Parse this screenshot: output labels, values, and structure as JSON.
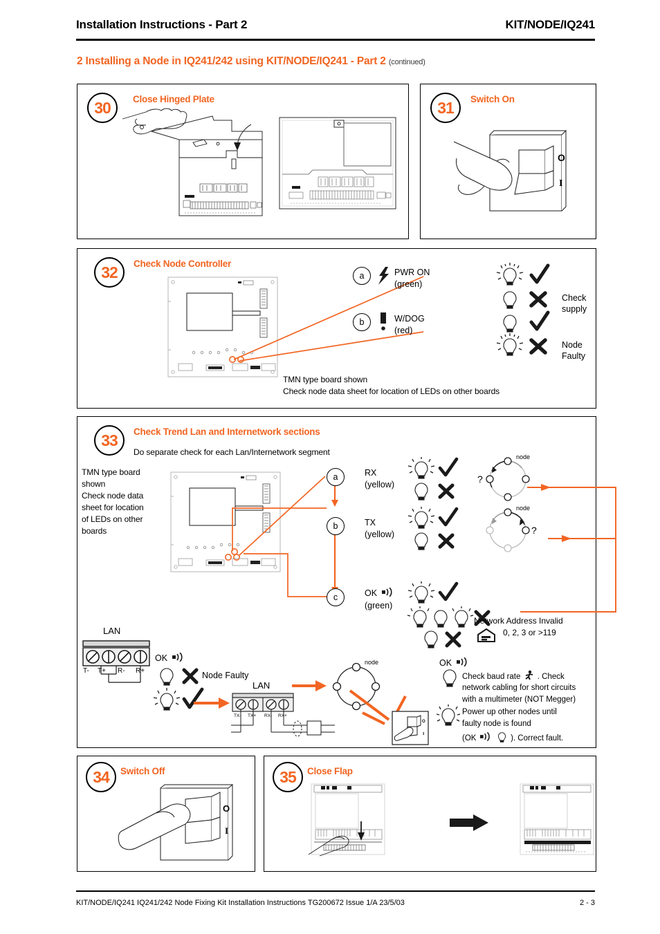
{
  "header": {
    "title": "Installation Instructions - Part 2",
    "product": "KIT/NODE/IQ241"
  },
  "section": {
    "heading": "2 Installing a Node in IQ241/242 using KIT/NODE/IQ241 - Part 2",
    "continued": "(continued)"
  },
  "steps": [
    {
      "number": "30",
      "title": "Close Hinged Plate"
    },
    {
      "number": "31",
      "title": "Switch On",
      "switch_labels": {
        "off": "O",
        "on": "I"
      }
    },
    {
      "number": "32",
      "title": "Check Node Controller",
      "callouts": [
        {
          "ref": "a",
          "icon": "lightning-icon",
          "led": "PWR ON",
          "colour": "(green)",
          "ok_result": "",
          "fail_result": "Check supply"
        },
        {
          "ref": "b",
          "icon": "exclamation-icon",
          "led": "W/DOG",
          "colour": "(red)",
          "ok_result": "",
          "fail_result": "Node Faulty"
        }
      ],
      "note_line1": "TMN type board shown",
      "note_line2": "Check node data sheet for location of LEDs on other boards"
    },
    {
      "number": "33",
      "title": "Check Trend Lan and Internetwork sections",
      "subtitle": "Do separate check for each Lan/Internetwork segment",
      "side_note": "TMN type board shown\nCheck node data sheet for location of LEDs on other boards",
      "side_note_lines": [
        "TMN type board",
        "shown",
        "Check node data",
        "sheet for location",
        "of LEDs on other",
        "boards"
      ],
      "callouts": [
        {
          "ref": "a",
          "led": "RX",
          "colour": "(yellow)",
          "ring_label": "node",
          "ring_query": "?"
        },
        {
          "ref": "b",
          "led": "TX",
          "colour": "(yellow)",
          "ring_label": "node",
          "ring_query": "?"
        },
        {
          "ref": "c",
          "led": "OK",
          "colour": "(green)"
        }
      ],
      "network_invalid_line1": "Network Address Invalid",
      "network_invalid_line2": "0, 2, 3 or >119",
      "lan_block": {
        "title": "LAN",
        "terminals": [
          "T-",
          "T+",
          "R-",
          "R+"
        ]
      },
      "lan_block2": {
        "title": "LAN",
        "terminals": [
          "TX-",
          "TX+",
          "RX-",
          "RX+"
        ]
      },
      "ok_label": "OK",
      "node_faulty": "Node Faulty",
      "ring_label": "node",
      "switch_labels": {
        "off": "O",
        "on": "I"
      },
      "advice": [
        "Check baud rate ",
        ". Check",
        "network cabling for short circuits",
        "with a multimeter (NOT Megger)",
        "Power up other nodes until",
        "faulty node is found",
        "). Correct fault."
      ],
      "advice_line1a": "Check baud rate",
      "advice_line1b": ". Check",
      "advice_line2": "network cabling for short circuits",
      "advice_line3": "with a multimeter (NOT Megger)",
      "advice_line4": "Power up other nodes until",
      "advice_line5": "faulty node is found",
      "advice_line6a": "(OK",
      "advice_line6b": "). Correct fault."
    },
    {
      "number": "34",
      "title": "Switch Off",
      "switch_labels": {
        "off": "O",
        "on": "I"
      }
    },
    {
      "number": "35",
      "title": "Close Flap"
    }
  ],
  "footer": {
    "text": "KIT/NODE/IQ241 IQ241/242 Node Fixing Kit Installation Instructions TG200672 Issue 1/A 23/5/03",
    "page": "2 - 3"
  },
  "colors": {
    "accent": "#F26522",
    "text": "#000000",
    "board_outline": "#4d4d4d"
  }
}
